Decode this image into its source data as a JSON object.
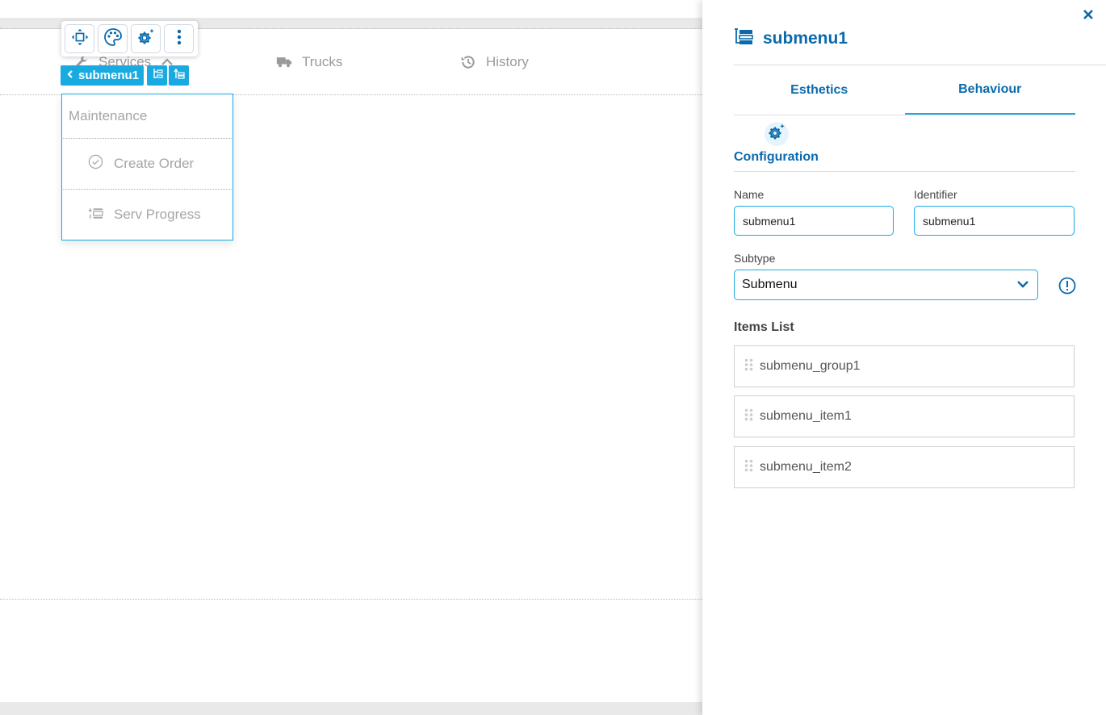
{
  "canvas": {
    "nav": [
      {
        "label": "Services",
        "icon": "wrench-icon"
      },
      {
        "label": "Trucks",
        "icon": "truck-icon"
      },
      {
        "label": "History",
        "icon": "history-icon"
      }
    ],
    "toolbar": {
      "tools": [
        "move-icon",
        "palette-icon",
        "settings-gear-icon",
        "more-vertical-icon"
      ]
    },
    "selection_tag": "submenu1",
    "submenu": {
      "group_label": "Maintenance",
      "items": [
        {
          "label": "Create Order",
          "icon": "check-circle-icon"
        },
        {
          "label": "Serv Progress",
          "icon": "list-progress-icon"
        }
      ]
    }
  },
  "panel": {
    "title": "submenu1",
    "tabs": [
      {
        "label": "Esthetics",
        "active": false
      },
      {
        "label": "Behaviour",
        "active": true
      }
    ],
    "section_label": "Configuration",
    "name_label": "Name",
    "name_value": "submenu1",
    "identifier_label": "Identifier",
    "identifier_value": "submenu1",
    "subtype_label": "Subtype",
    "subtype_value": "Submenu",
    "items_title": "Items List",
    "items": [
      "submenu_group1",
      "submenu_item1",
      "submenu_item2"
    ]
  },
  "colors": {
    "accent": "#1aaae2",
    "primary_text": "#0a6aad",
    "muted": "#9a9a9a"
  }
}
